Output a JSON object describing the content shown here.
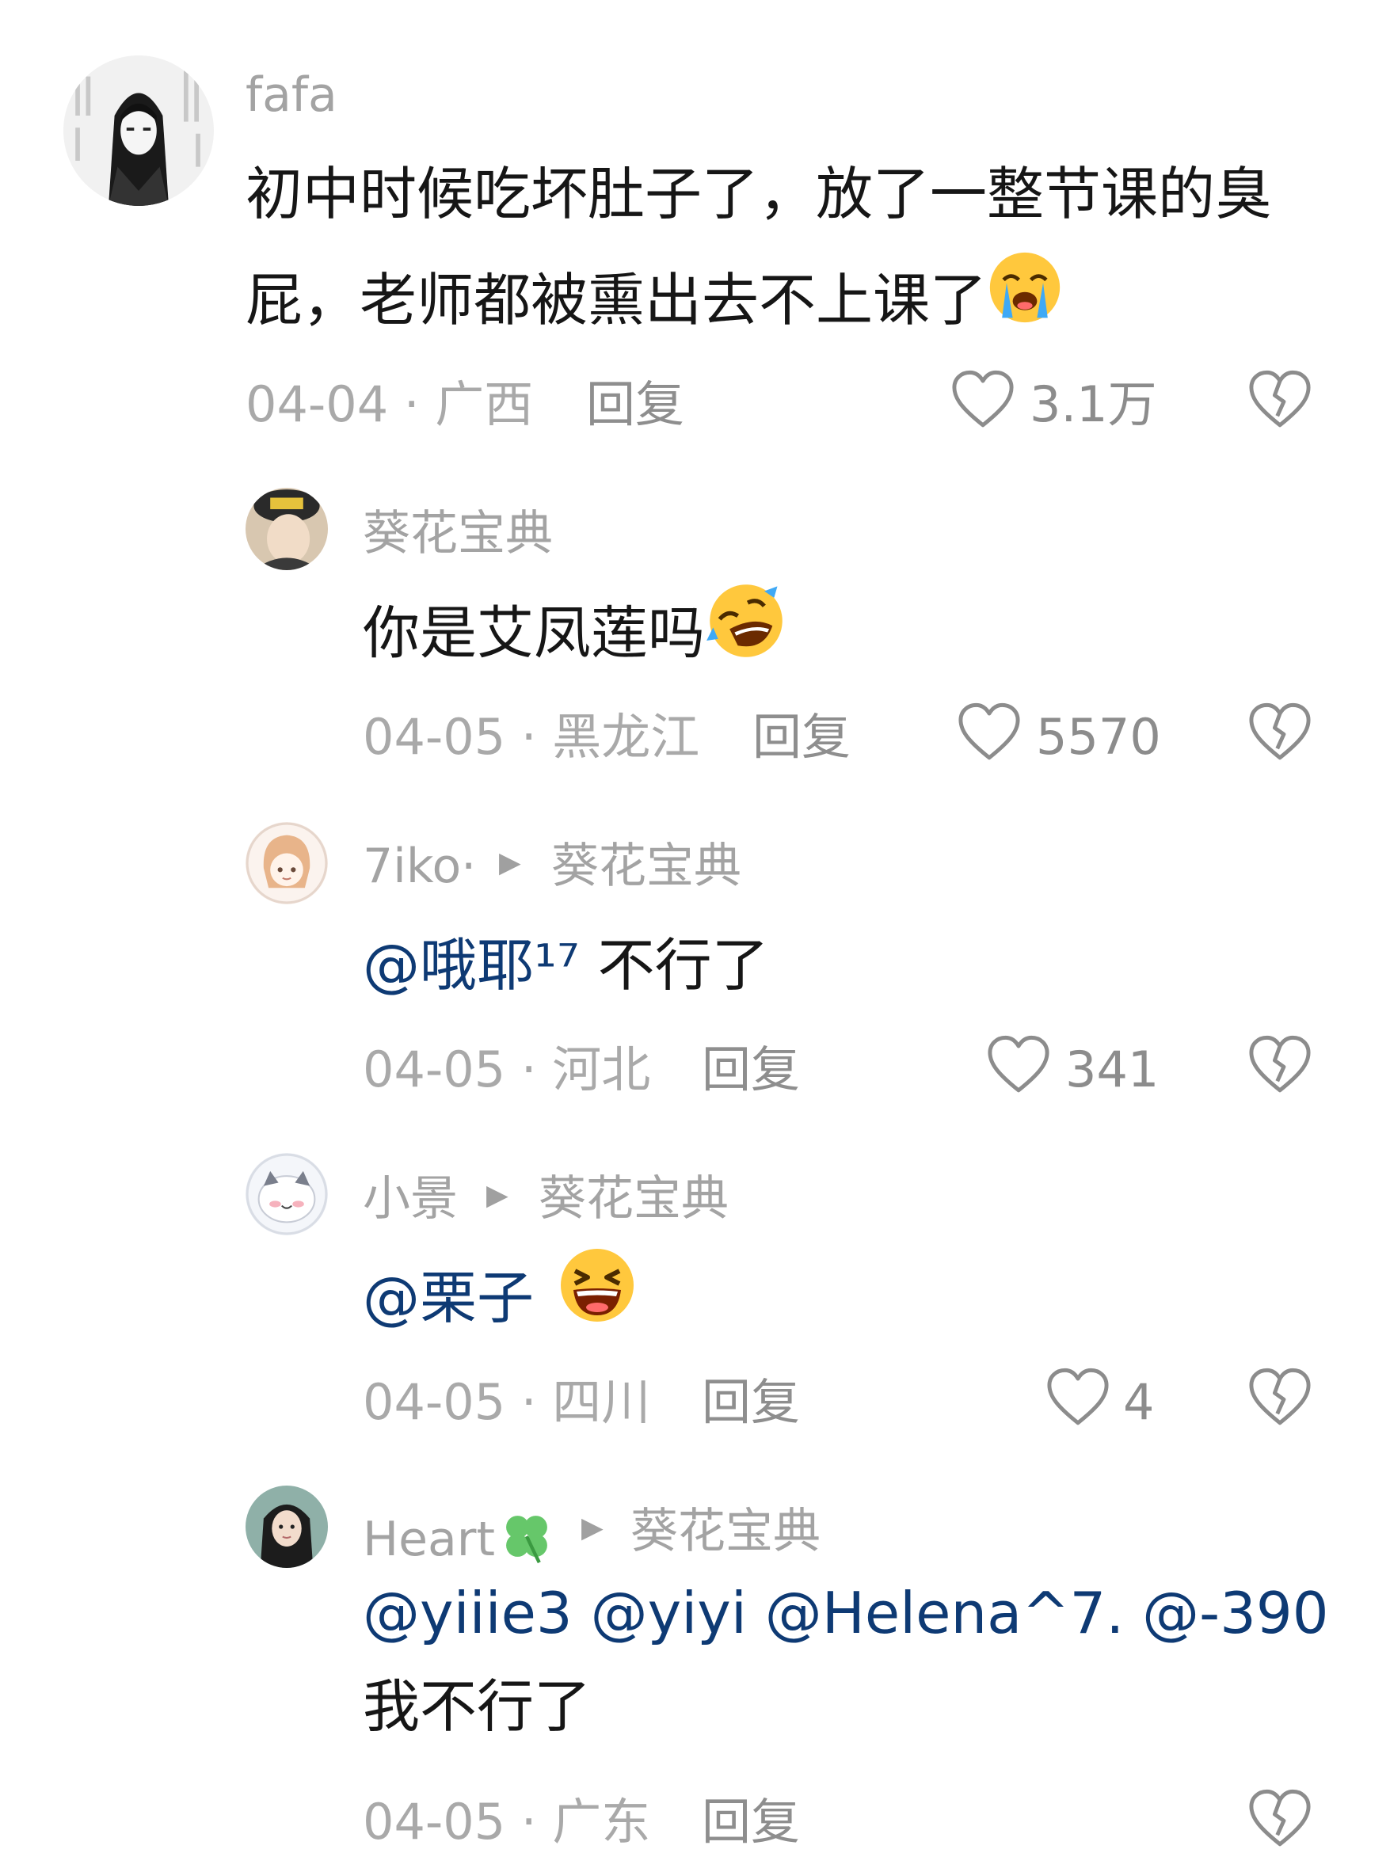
{
  "comments": [
    {
      "username": "fafa",
      "content_line1": "初中时候吃坏肚子了，放了一整节课的臭",
      "content_line2": "屁，老师都被熏出去不上课了",
      "date_location": "04-04 · 广西",
      "reply_label": "回复",
      "like_count": "3.1万",
      "emoji": "loudly-crying-face"
    },
    {
      "username": "葵花宝典",
      "content": "你是艾凤莲吗",
      "date_location": "04-05 · 黑龙江",
      "reply_label": "回复",
      "like_count": "5570",
      "emoji": "rolling-laughing-face"
    },
    {
      "username": "7iko·",
      "reply_to": "葵花宝典",
      "mention": "@哦耶¹⁷",
      "content": " 不行了",
      "date_location": "04-05 · 河北",
      "reply_label": "回复",
      "like_count": "341"
    },
    {
      "username": "小景",
      "reply_to": "葵花宝典",
      "mention": "@栗子",
      "date_location": "04-05 · 四川",
      "reply_label": "回复",
      "like_count": "4",
      "emoji": "grinning-squinting-face"
    },
    {
      "username": "Heart",
      "username_emoji": "four-leaf-clover",
      "reply_to": "葵花宝典",
      "mentions": "@yiiie3 @yiyi @Helena^7. @-390",
      "content": "我不行了",
      "date_location": "04-05 · 广东",
      "reply_label": "回复"
    }
  ],
  "colors": {
    "mention": "#0e3a74",
    "meta": "#a9a9a9",
    "username": "#a3a3a3",
    "text": "#161616"
  }
}
